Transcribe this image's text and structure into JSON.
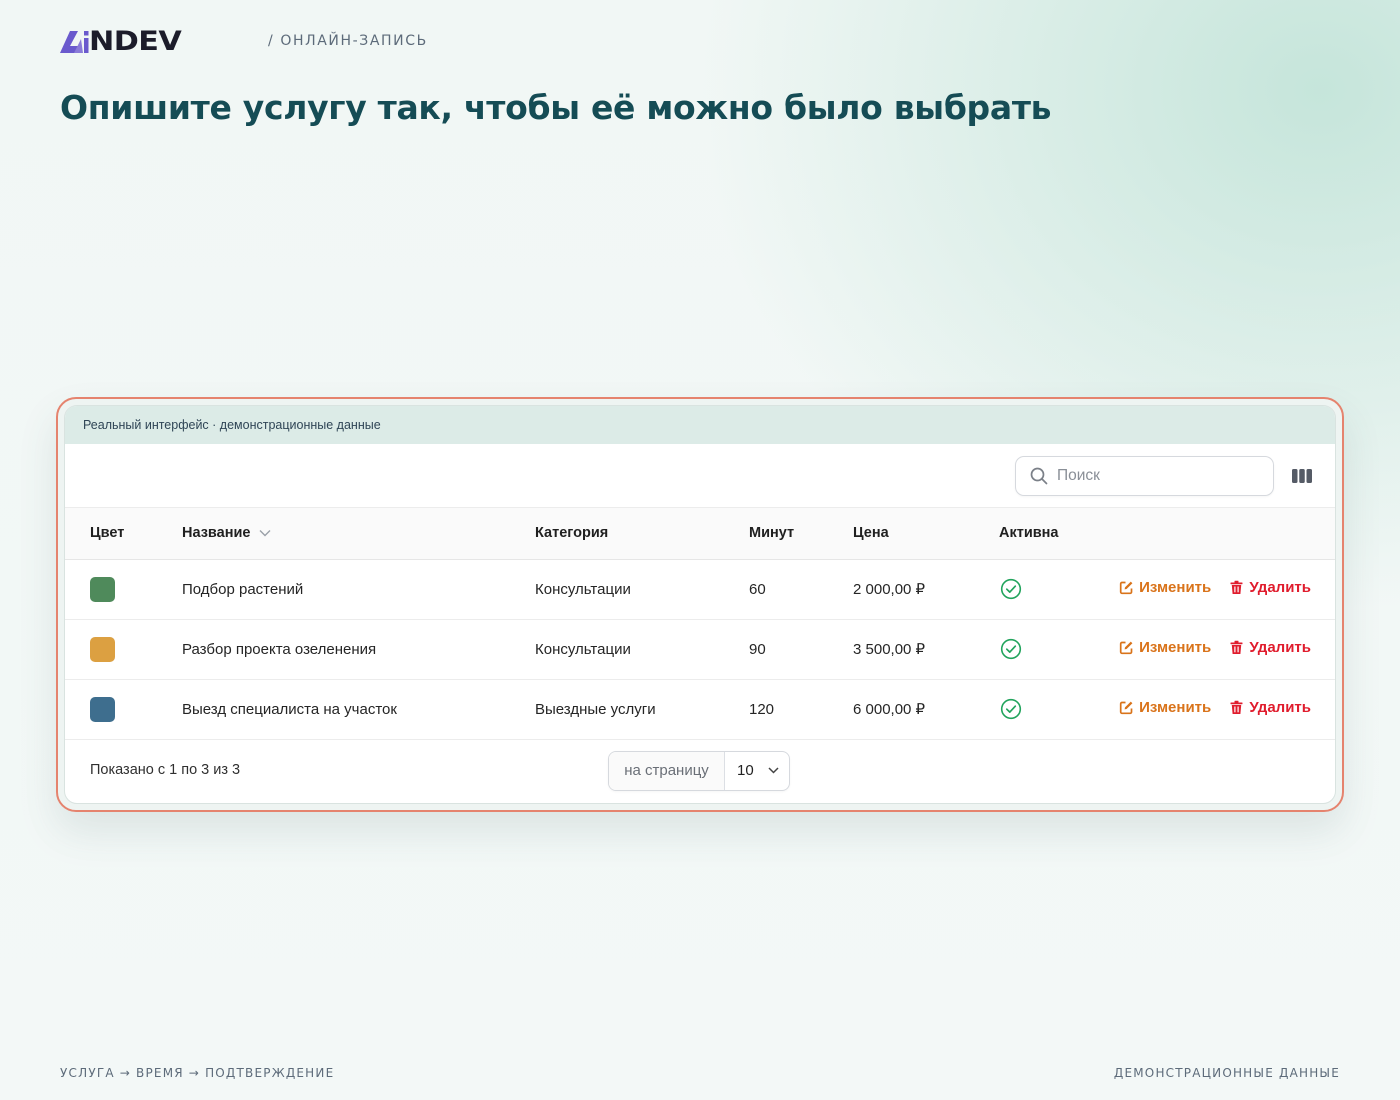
{
  "brand": {
    "logo_text": "NDEV",
    "logo_accent_color": "#6a5acd"
  },
  "header": {
    "crumb": "/ ОНЛАЙН-ЗАПИСЬ",
    "headline": "Опишите услугу так, чтобы её можно было выбрать"
  },
  "demo_panel": {
    "banner": "Реальный интерфейс · демонстрационные данные",
    "search": {
      "placeholder": "Поиск",
      "value": ""
    },
    "columns_icon": "columns-icon",
    "table": {
      "headers": {
        "color": "Цвет",
        "name": "Название",
        "category": "Категория",
        "minutes": "Минут",
        "price": "Цена",
        "active": "Активна"
      },
      "sorted_by": "name",
      "rows": [
        {
          "color": "#4f8a5b",
          "name": "Подбор растений",
          "category": "Консультации",
          "minutes": "60",
          "price": "2 000,00 ₽",
          "active": true
        },
        {
          "color": "#dca041",
          "name": "Разбор проекта озеленения",
          "category": "Консультации",
          "minutes": "90",
          "price": "3 500,00 ₽",
          "active": true
        },
        {
          "color": "#3e6e8e",
          "name": "Выезд специалиста на участок",
          "category": "Выездные услуги",
          "minutes": "120",
          "price": "6 000,00 ₽",
          "active": true
        }
      ],
      "actions": {
        "edit": "Изменить",
        "delete": "Удалить"
      }
    },
    "pagination": {
      "shown": "Показано с 1 по 3 из 3",
      "per_page_label": "на страницу",
      "per_page_value": "10"
    }
  },
  "footer": {
    "left": "УСЛУГА → ВРЕМЯ → ПОДТВЕРЖДЕНИЕ",
    "right": "ДЕМОНСТРАЦИОННЫЕ ДАННЫЕ"
  },
  "colors": {
    "accent_frame": "#e5836e",
    "headline": "#154c55",
    "edit": "#d9731a",
    "delete": "#e01c2d",
    "active_ok": "#22a45d"
  }
}
